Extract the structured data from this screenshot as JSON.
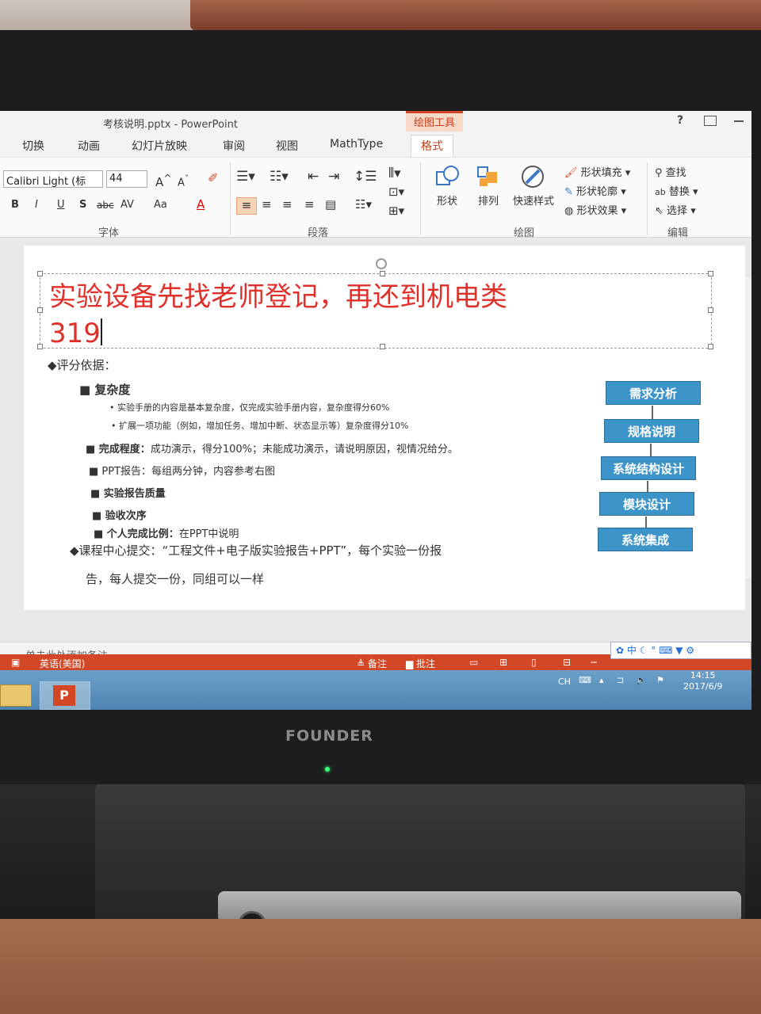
{
  "window": {
    "title": "考核说明.pptx - PowerPoint",
    "contextual_tab_label": "绘图工具",
    "help": "?"
  },
  "tabs": [
    "切换",
    "动画",
    "幻灯片放映",
    "审阅",
    "视图",
    "MathType",
    "格式"
  ],
  "ribbon": {
    "font": {
      "name": "Calibri Light (标",
      "size": "44",
      "label": "字体"
    },
    "paragraph": {
      "label": "段落"
    },
    "drawing": {
      "label": "绘图",
      "shape": "形状",
      "arrange": "排列",
      "quick_styles": "快速样式",
      "fill": "形状填充",
      "outline": "形状轮廓",
      "effects": "形状效果"
    },
    "editing": {
      "label": "编辑",
      "find": "查找",
      "replace": "替换",
      "select": "选择"
    },
    "format_buttons": [
      "B",
      "I",
      "U",
      "S",
      "abc",
      "AV",
      "Aa",
      "A"
    ]
  },
  "slide": {
    "heading_line1": "实验设备先找老师登记，再还到机电类",
    "heading_line2": "319",
    "scoring_basis": "◆评分依据：",
    "complexity": "■ 复杂度",
    "complexity_item1": "• 实验手册的内容是基本复杂度，仅完成实验手册内容，复杂度得分60%",
    "complexity_item2": "• 扩展一项功能（例如，增加任务、增加中断、状态显示等）复杂度得分10%",
    "completion_label": "■ 完成程度：",
    "completion_text": "成功演示，得分100%；未能成功演示，请说明原因，视情况给分。",
    "ppt_label": "■ PPT报告：",
    "ppt_text": "每组两分钟，内容参考右图",
    "report_quality": "■ 实验报告质量",
    "acceptance_order": "■ 验收次序",
    "ratio_label": "■ 个人完成比例：",
    "ratio_text": "在PPT中说明",
    "submit_line1": "◆课程中心提交：“工程文件+电子版实验报告+PPT”，每个实验一份报",
    "submit_line2": "告，每人提交一份，同组可以一样",
    "flow": [
      "需求分析",
      "规格说明",
      "系统结构设计",
      "模块设计",
      "系统集成"
    ]
  },
  "notes_placeholder": "单击此处添加备注",
  "statusbar": {
    "language": "英语(美国)",
    "notes": "备注",
    "comments": "批注"
  },
  "ime": "中",
  "taskbar": {
    "ppt_icon": "P",
    "lang": "CH",
    "time": "14:15",
    "date": "2017/6/9"
  },
  "brand": "FOUNDER",
  "colors": {
    "accent": "#d24726",
    "heading_red": "#e0302a",
    "flow_blue": "#3d94c8"
  }
}
